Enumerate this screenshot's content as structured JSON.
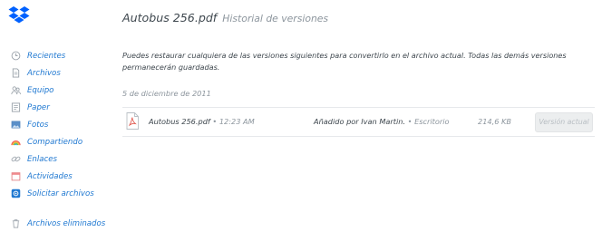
{
  "colors": {
    "accent": "#1f78d1",
    "text": "#3d464d",
    "muted": "#8c959d",
    "divider": "#e6e8eb",
    "rainbow": [
      "#f25c54",
      "#f8b133",
      "#6fc24e",
      "#3aa6e5"
    ]
  },
  "logo": {
    "icon": "dropbox-logo-icon"
  },
  "sidebar": {
    "items": [
      {
        "label": "Recientes",
        "icon": "clock-icon"
      },
      {
        "label": "Archivos",
        "icon": "file-icon"
      },
      {
        "label": "Equipo",
        "icon": "team-icon"
      },
      {
        "label": "Paper",
        "icon": "paper-icon"
      },
      {
        "label": "Fotos",
        "icon": "photo-icon"
      },
      {
        "label": "Compartiendo",
        "icon": "rainbow-icon"
      },
      {
        "label": "Enlaces",
        "icon": "link-icon"
      },
      {
        "label": "Actividades",
        "icon": "calendar-icon"
      },
      {
        "label": "Solicitar archivos",
        "icon": "file-request-icon"
      }
    ],
    "deleted": {
      "label": "Archivos eliminados",
      "icon": "trash-icon"
    }
  },
  "header": {
    "file_name": "Autobus 256.pdf",
    "subtitle": "Historial de versiones"
  },
  "intro_text": "Puedes restaurar cualquiera de las versiones siguientes para convertirlo en el archivo actual. Todas las demás versiones permanecerán guardadas.",
  "versions": [
    {
      "date": "5 de diciembre de 2011",
      "file_name": "Autobus 256.pdf",
      "time": " • 12:23 AM",
      "added_by": "Añadido por Ivan Martin.",
      "location": " • Escritorio",
      "size": "214,6 KB",
      "action": "Versión actual",
      "file_icon": "pdf-file-icon"
    }
  ]
}
